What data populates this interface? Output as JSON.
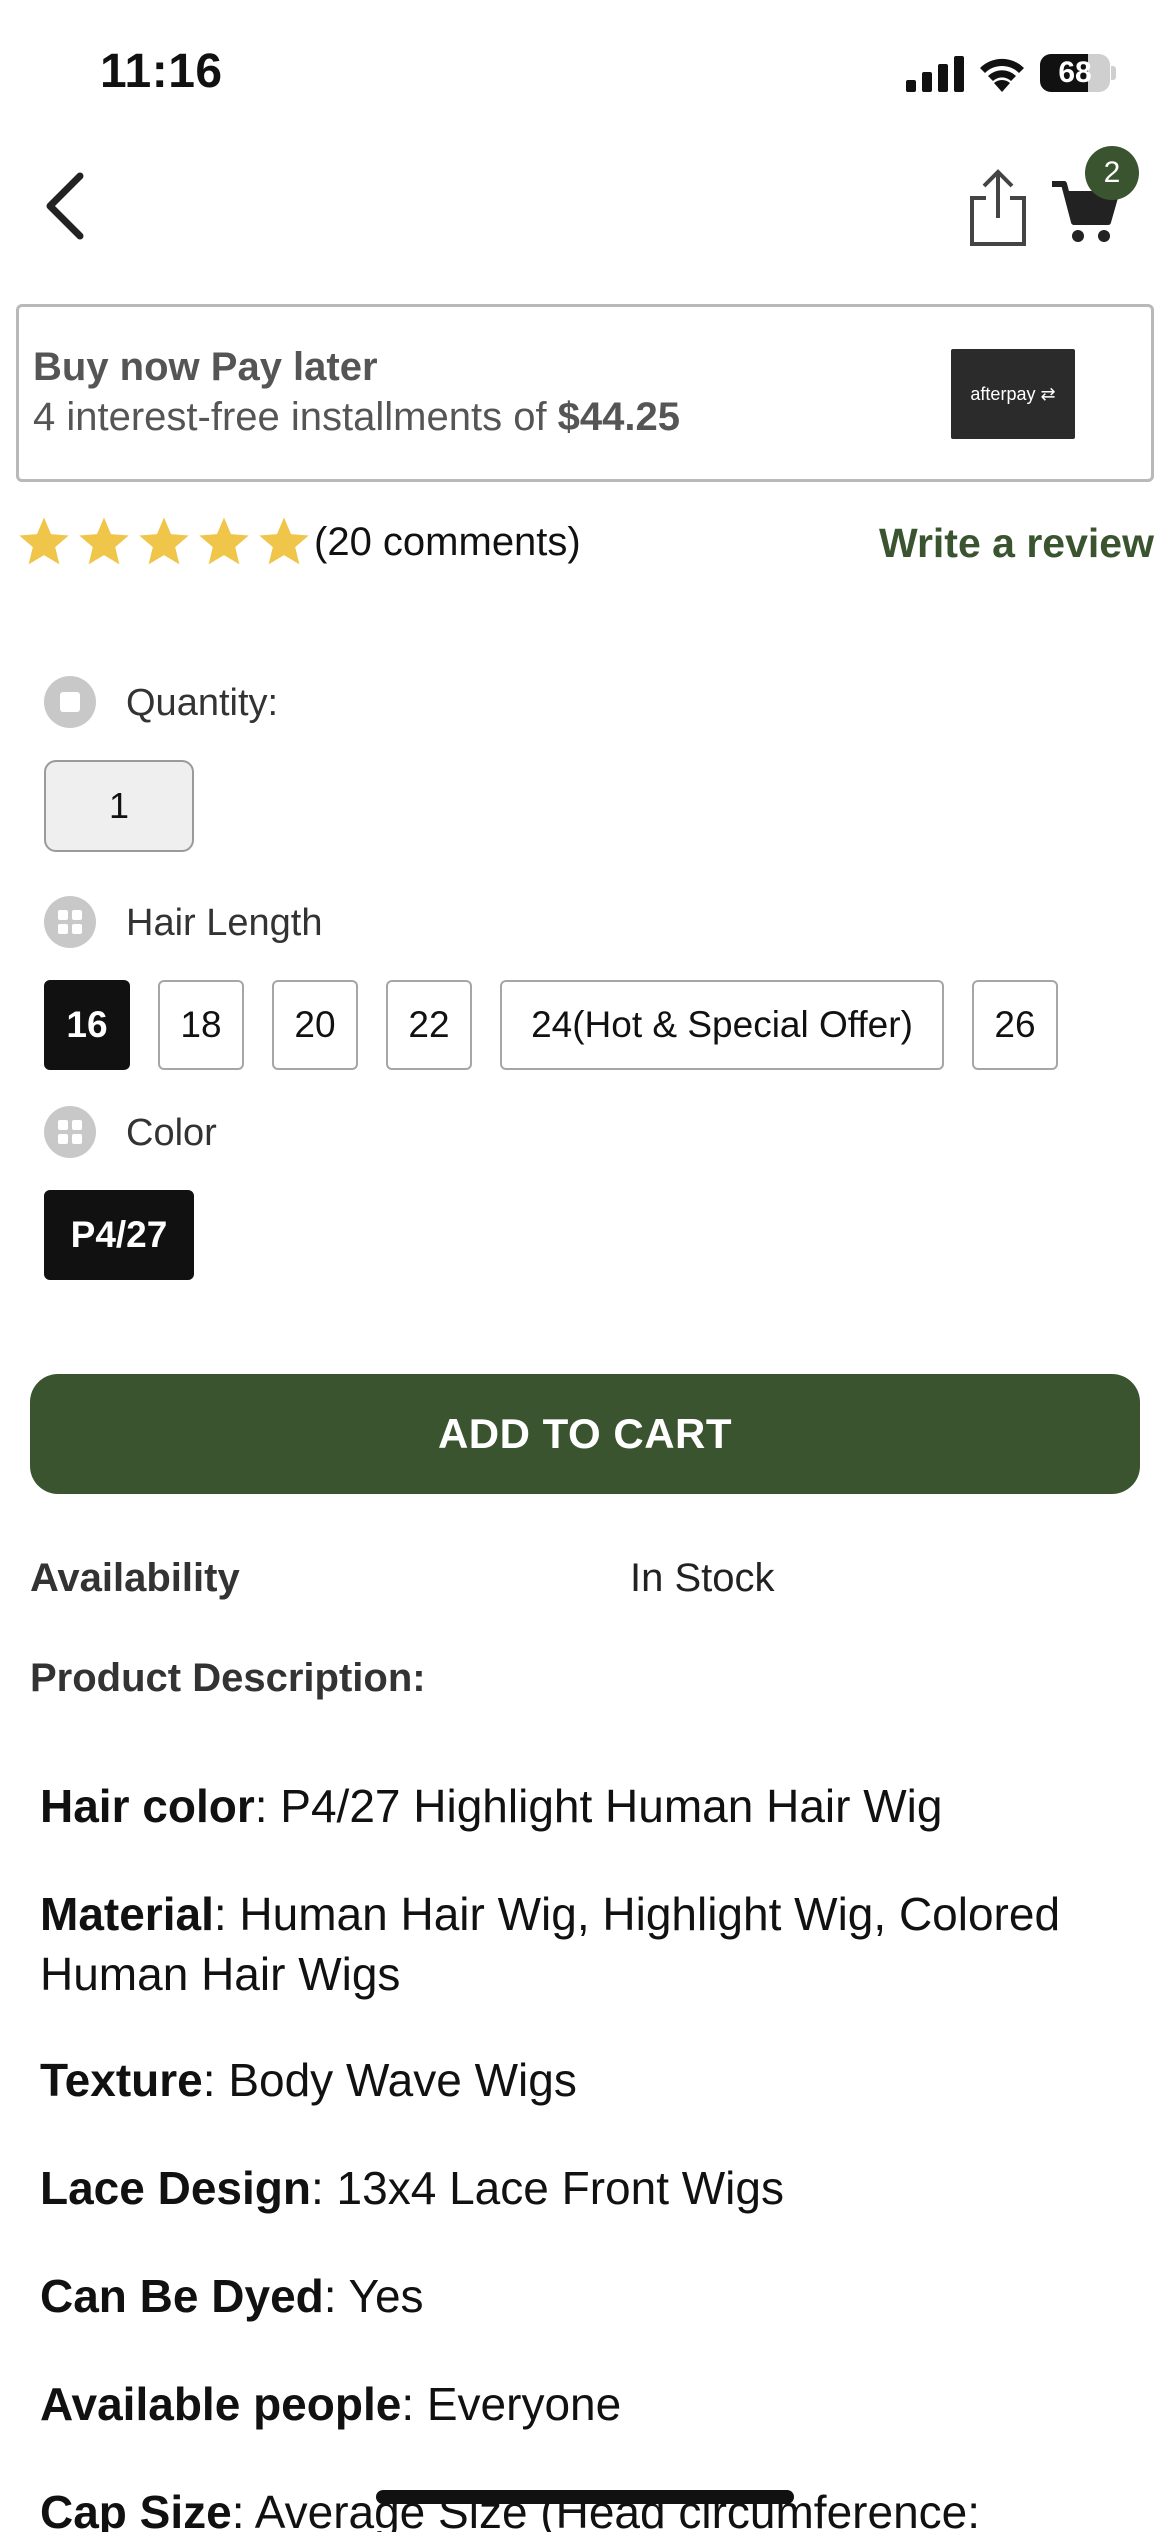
{
  "status_bar": {
    "time": "11:16",
    "battery_percent": "68",
    "battery_level": 0.68
  },
  "nav": {
    "cart_count": "2"
  },
  "bnpl": {
    "title": "Buy now Pay later",
    "installments_text": "4 interest-free installments of ",
    "installment_amount": "$44.25",
    "logo_text": "afterpay"
  },
  "rating": {
    "stars": 5,
    "comments": "(20 comments)",
    "write_review": "Write a review"
  },
  "options": {
    "quantity_label": "Quantity:",
    "quantity_value": "1",
    "hair_length_label": "Hair Length",
    "hair_lengths": [
      "16",
      "18",
      "20",
      "22",
      "24(Hot & Special Offer)",
      "26"
    ],
    "hair_length_selected": "16",
    "color_label": "Color",
    "colors": [
      "P4/27"
    ],
    "color_selected": "P4/27"
  },
  "add_to_cart": "ADD TO CART",
  "availability": {
    "label": "Availability",
    "value": "In Stock"
  },
  "description": {
    "title": "Product Description:",
    "items": [
      {
        "key": "Hair color",
        "value": ": P4/27 Highlight Human Hair Wig"
      },
      {
        "key": "Material",
        "value": ": Human Hair Wig, Highlight Wig, Colored Human Hair Wigs"
      },
      {
        "key": "Texture",
        "value": ": Body Wave Wigs"
      },
      {
        "key": "Lace Design",
        "value": ": 13x4 Lace Front Wigs"
      },
      {
        "key": "Can Be Dyed",
        "value": ": Yes"
      },
      {
        "key": "Available people",
        "value": ": Everyone"
      },
      {
        "key": "Cap Size",
        "value": ": Average Size (Head circumference:"
      }
    ]
  },
  "colors": {
    "accent": "#3b5430",
    "selected_chip": "#111111"
  }
}
